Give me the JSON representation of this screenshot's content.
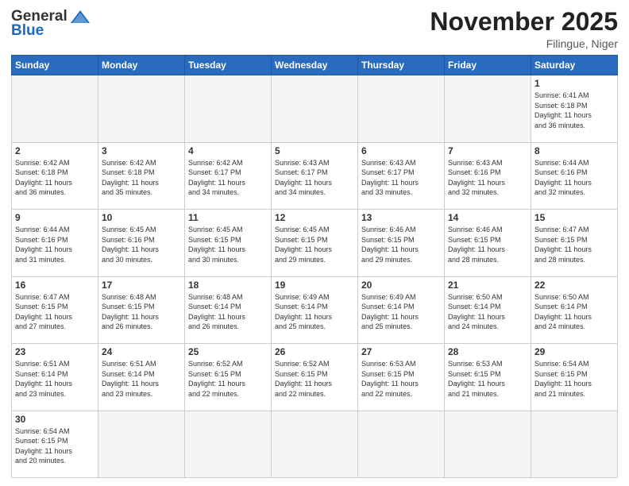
{
  "header": {
    "logo_general": "General",
    "logo_blue": "Blue",
    "month_title": "November 2025",
    "subtitle": "Filingue, Niger"
  },
  "weekdays": [
    "Sunday",
    "Monday",
    "Tuesday",
    "Wednesday",
    "Thursday",
    "Friday",
    "Saturday"
  ],
  "weeks": [
    [
      {
        "day": "",
        "info": ""
      },
      {
        "day": "",
        "info": ""
      },
      {
        "day": "",
        "info": ""
      },
      {
        "day": "",
        "info": ""
      },
      {
        "day": "",
        "info": ""
      },
      {
        "day": "",
        "info": ""
      },
      {
        "day": "1",
        "info": "Sunrise: 6:41 AM\nSunset: 6:18 PM\nDaylight: 11 hours\nand 36 minutes."
      }
    ],
    [
      {
        "day": "2",
        "info": "Sunrise: 6:42 AM\nSunset: 6:18 PM\nDaylight: 11 hours\nand 36 minutes."
      },
      {
        "day": "3",
        "info": "Sunrise: 6:42 AM\nSunset: 6:18 PM\nDaylight: 11 hours\nand 35 minutes."
      },
      {
        "day": "4",
        "info": "Sunrise: 6:42 AM\nSunset: 6:17 PM\nDaylight: 11 hours\nand 34 minutes."
      },
      {
        "day": "5",
        "info": "Sunrise: 6:43 AM\nSunset: 6:17 PM\nDaylight: 11 hours\nand 34 minutes."
      },
      {
        "day": "6",
        "info": "Sunrise: 6:43 AM\nSunset: 6:17 PM\nDaylight: 11 hours\nand 33 minutes."
      },
      {
        "day": "7",
        "info": "Sunrise: 6:43 AM\nSunset: 6:16 PM\nDaylight: 11 hours\nand 32 minutes."
      },
      {
        "day": "8",
        "info": "Sunrise: 6:44 AM\nSunset: 6:16 PM\nDaylight: 11 hours\nand 32 minutes."
      }
    ],
    [
      {
        "day": "9",
        "info": "Sunrise: 6:44 AM\nSunset: 6:16 PM\nDaylight: 11 hours\nand 31 minutes."
      },
      {
        "day": "10",
        "info": "Sunrise: 6:45 AM\nSunset: 6:16 PM\nDaylight: 11 hours\nand 30 minutes."
      },
      {
        "day": "11",
        "info": "Sunrise: 6:45 AM\nSunset: 6:15 PM\nDaylight: 11 hours\nand 30 minutes."
      },
      {
        "day": "12",
        "info": "Sunrise: 6:45 AM\nSunset: 6:15 PM\nDaylight: 11 hours\nand 29 minutes."
      },
      {
        "day": "13",
        "info": "Sunrise: 6:46 AM\nSunset: 6:15 PM\nDaylight: 11 hours\nand 29 minutes."
      },
      {
        "day": "14",
        "info": "Sunrise: 6:46 AM\nSunset: 6:15 PM\nDaylight: 11 hours\nand 28 minutes."
      },
      {
        "day": "15",
        "info": "Sunrise: 6:47 AM\nSunset: 6:15 PM\nDaylight: 11 hours\nand 28 minutes."
      }
    ],
    [
      {
        "day": "16",
        "info": "Sunrise: 6:47 AM\nSunset: 6:15 PM\nDaylight: 11 hours\nand 27 minutes."
      },
      {
        "day": "17",
        "info": "Sunrise: 6:48 AM\nSunset: 6:15 PM\nDaylight: 11 hours\nand 26 minutes."
      },
      {
        "day": "18",
        "info": "Sunrise: 6:48 AM\nSunset: 6:14 PM\nDaylight: 11 hours\nand 26 minutes."
      },
      {
        "day": "19",
        "info": "Sunrise: 6:49 AM\nSunset: 6:14 PM\nDaylight: 11 hours\nand 25 minutes."
      },
      {
        "day": "20",
        "info": "Sunrise: 6:49 AM\nSunset: 6:14 PM\nDaylight: 11 hours\nand 25 minutes."
      },
      {
        "day": "21",
        "info": "Sunrise: 6:50 AM\nSunset: 6:14 PM\nDaylight: 11 hours\nand 24 minutes."
      },
      {
        "day": "22",
        "info": "Sunrise: 6:50 AM\nSunset: 6:14 PM\nDaylight: 11 hours\nand 24 minutes."
      }
    ],
    [
      {
        "day": "23",
        "info": "Sunrise: 6:51 AM\nSunset: 6:14 PM\nDaylight: 11 hours\nand 23 minutes."
      },
      {
        "day": "24",
        "info": "Sunrise: 6:51 AM\nSunset: 6:14 PM\nDaylight: 11 hours\nand 23 minutes."
      },
      {
        "day": "25",
        "info": "Sunrise: 6:52 AM\nSunset: 6:15 PM\nDaylight: 11 hours\nand 22 minutes."
      },
      {
        "day": "26",
        "info": "Sunrise: 6:52 AM\nSunset: 6:15 PM\nDaylight: 11 hours\nand 22 minutes."
      },
      {
        "day": "27",
        "info": "Sunrise: 6:53 AM\nSunset: 6:15 PM\nDaylight: 11 hours\nand 22 minutes."
      },
      {
        "day": "28",
        "info": "Sunrise: 6:53 AM\nSunset: 6:15 PM\nDaylight: 11 hours\nand 21 minutes."
      },
      {
        "day": "29",
        "info": "Sunrise: 6:54 AM\nSunset: 6:15 PM\nDaylight: 11 hours\nand 21 minutes."
      }
    ],
    [
      {
        "day": "30",
        "info": "Sunrise: 6:54 AM\nSunset: 6:15 PM\nDaylight: 11 hours\nand 20 minutes."
      },
      {
        "day": "",
        "info": ""
      },
      {
        "day": "",
        "info": ""
      },
      {
        "day": "",
        "info": ""
      },
      {
        "day": "",
        "info": ""
      },
      {
        "day": "",
        "info": ""
      },
      {
        "day": "",
        "info": ""
      }
    ]
  ]
}
